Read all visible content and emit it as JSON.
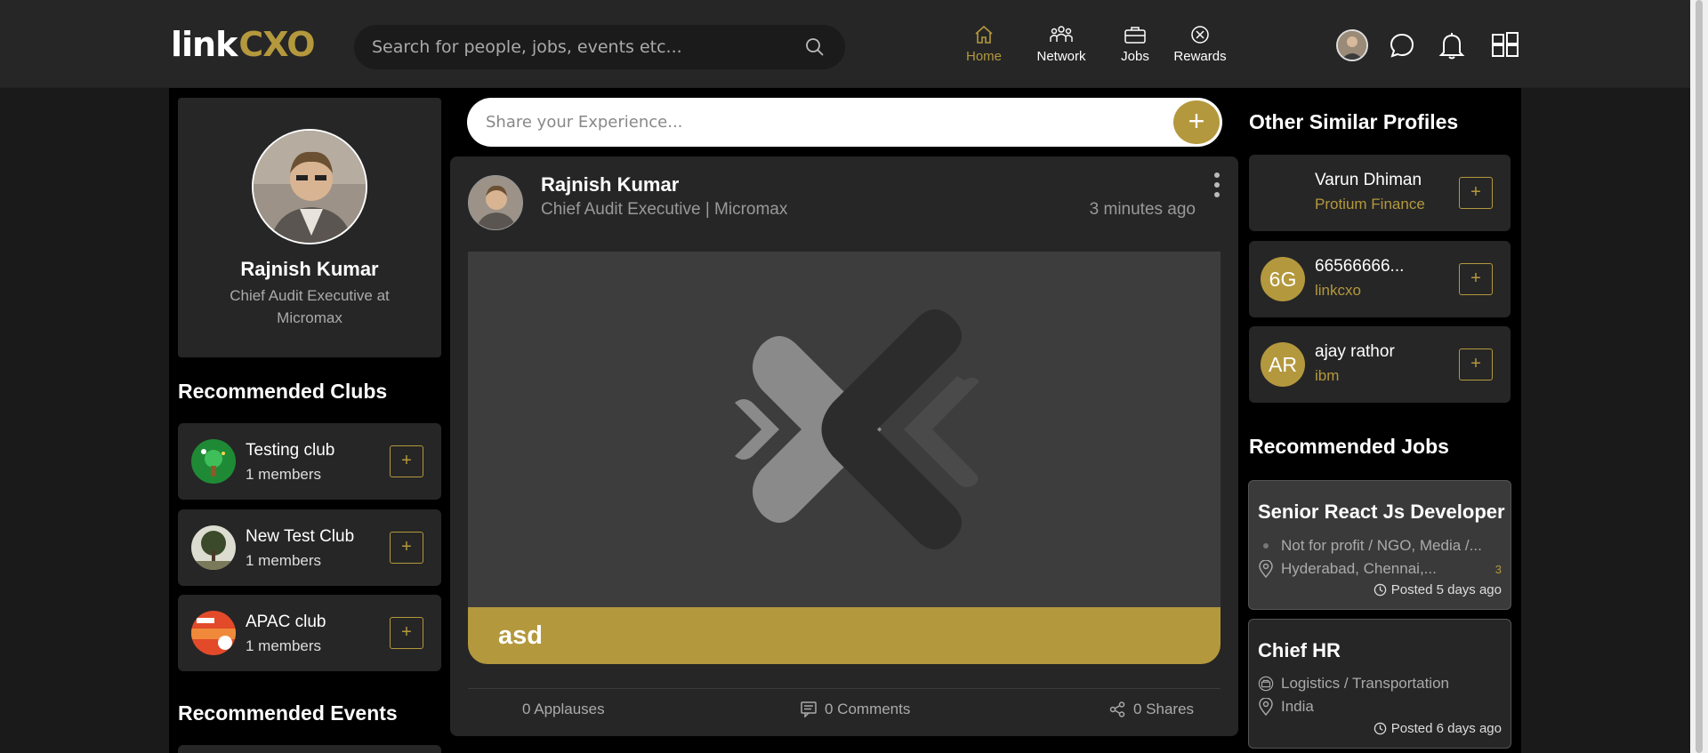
{
  "header": {
    "logo_left": "link",
    "logo_right": "CXO",
    "search_placeholder": "Search for people, jobs, events etc...",
    "nav": [
      {
        "label": "Home",
        "icon": "home-icon",
        "active": true
      },
      {
        "label": "Network",
        "icon": "network-icon",
        "active": false
      },
      {
        "label": "Jobs",
        "icon": "briefcase-icon",
        "active": false
      },
      {
        "label": "Rewards",
        "icon": "rewards-icon",
        "active": false
      }
    ]
  },
  "profile": {
    "name": "Rajnish Kumar",
    "role": "Chief Audit Executive at Micromax"
  },
  "clubs": {
    "title": "Recommended Clubs",
    "items": [
      {
        "name": "Testing club",
        "members": "1 members"
      },
      {
        "name": "New Test Club",
        "members": "1 members"
      },
      {
        "name": "APAC club",
        "members": "1 members"
      }
    ],
    "add_label": "+"
  },
  "events": {
    "title": "Recommended Events"
  },
  "share": {
    "placeholder": "Share your Experience...",
    "button": "+"
  },
  "post": {
    "author": "Rajnish Kumar",
    "role": "Chief Audit Executive | Micromax",
    "time": "3 minutes ago",
    "caption": "asd",
    "applauses": "0 Applauses",
    "comments": "0 Comments",
    "shares": "0 Shares"
  },
  "similar": {
    "title": "Other Similar Profiles",
    "items": [
      {
        "name": "Varun Dhiman",
        "company": "Protium Finance",
        "initials": ""
      },
      {
        "name": "66566666...",
        "company": "linkcxo",
        "initials": "6G"
      },
      {
        "name": "ajay rathor",
        "company": "ibm",
        "initials": "AR"
      }
    ]
  },
  "jobs": {
    "title": "Recommended Jobs",
    "items": [
      {
        "title": "Senior React Js Developer",
        "industry": "Not for profit / NGO, Media /...",
        "location": "Hyderabad, Chennai,...",
        "extra": "3",
        "posted": "Posted 5 days ago"
      },
      {
        "title": "Chief HR",
        "industry": "Logistics / Transportation",
        "location": "India",
        "extra": "",
        "posted": "Posted 6 days ago"
      }
    ]
  },
  "colors": {
    "accent": "#b4983d",
    "bg": "#000000",
    "card": "#262626"
  }
}
